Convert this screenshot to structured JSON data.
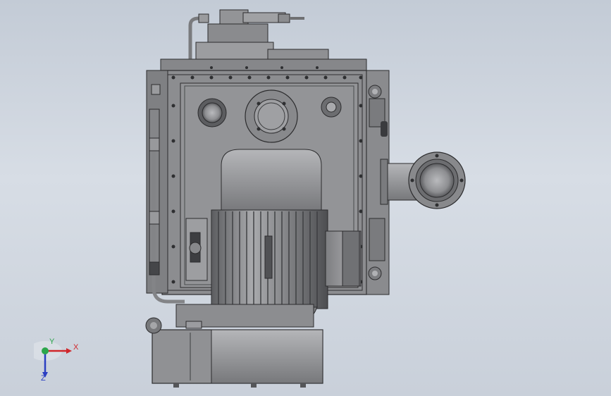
{
  "viewport": {
    "background_top": "#c3cbd6",
    "background_bottom": "#c9d0da"
  },
  "model": {
    "body_color": "#8e8f92",
    "dark_color": "#3c3d40",
    "light_color": "#b8b9bc"
  },
  "triad": {
    "x_label": "X",
    "y_label": "Y",
    "z_label": "Z",
    "x_color": "#d0262b",
    "y_color": "#2ca64b",
    "z_color": "#2b3fc2"
  }
}
